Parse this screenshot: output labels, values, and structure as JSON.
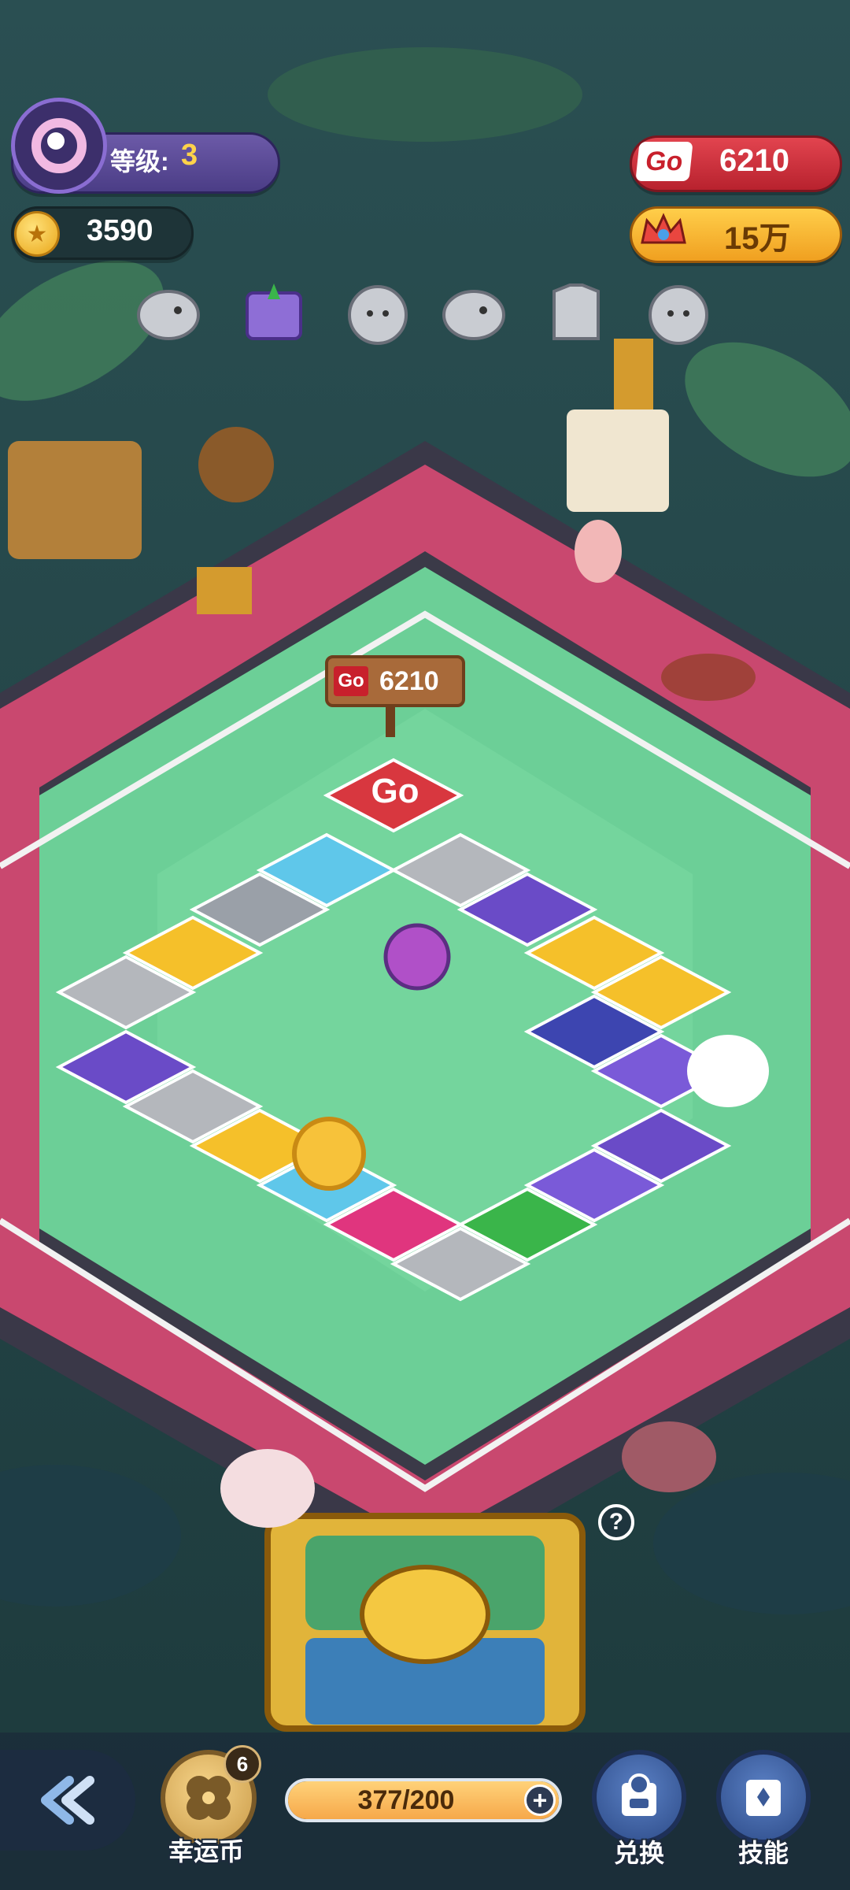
{
  "hud": {
    "level_label": "等级:",
    "level_value": "3",
    "coins": "3590",
    "go_badge": "Go",
    "go_points": "6210",
    "crown_amount": "15万"
  },
  "collection": {
    "items": [
      "fish-icon",
      "book-icon",
      "bird-icon",
      "fish-icon",
      "shirt-icon",
      "bird-icon"
    ]
  },
  "board": {
    "signpost_badge": "Go",
    "signpost_value": "6210",
    "start_tile": "Go"
  },
  "bottom": {
    "lucky_coin_label": "幸运币",
    "lucky_coin_count": "6",
    "progress_text": "377/200",
    "progress_fraction": 1.0,
    "exchange_label": "兑换",
    "skills_label": "技能",
    "help": "?"
  },
  "colors": {
    "board_green": "#6fcf9a",
    "path_pink": "#c7476e",
    "purple_tile": "#6a4bc7",
    "yellow_tile": "#f5c02a",
    "red_tile": "#d8373f"
  }
}
